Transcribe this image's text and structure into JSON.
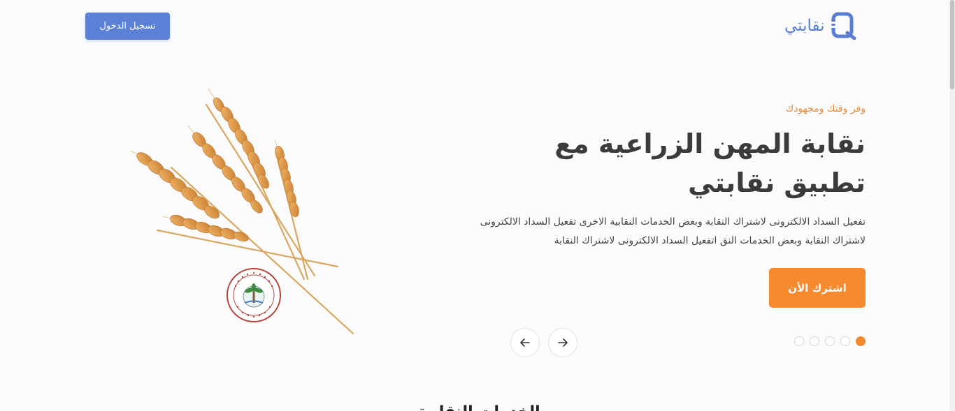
{
  "header": {
    "logo_text": "نقابتي",
    "logo_icon": "logo-q-icon",
    "login_label": "تسجيل الدخول"
  },
  "hero": {
    "tagline": "وفر وقتك ومجهودك",
    "title": "نقابة المهن الزراعية مع تطبيق نقابتي",
    "description": "تفعيل السداد الالكترونى لاشتراك النقابة وبعض الخدمات النقابية الاخرى تفعيل السداد الالكترونى لاشتراك النقابة وبعض الخدمات النق اتفعيل السداد الالكترونى لاشتراك النقابة",
    "cta_label": "اشترك الأن",
    "image": "wheat-illustration",
    "seal_text": "جمهورية مصر العربية",
    "seal_subtext": "نقابة المهن الزراعية"
  },
  "slider": {
    "dot_count": 5,
    "active_index": 0,
    "next_icon": "arrow-right-icon",
    "prev_icon": "arrow-left-icon"
  },
  "section": {
    "heading": "الخدمات النقابية"
  },
  "colors": {
    "primary": "#5b80d6",
    "accent": "#f58a2e",
    "text_dark": "#3b3b3b"
  }
}
